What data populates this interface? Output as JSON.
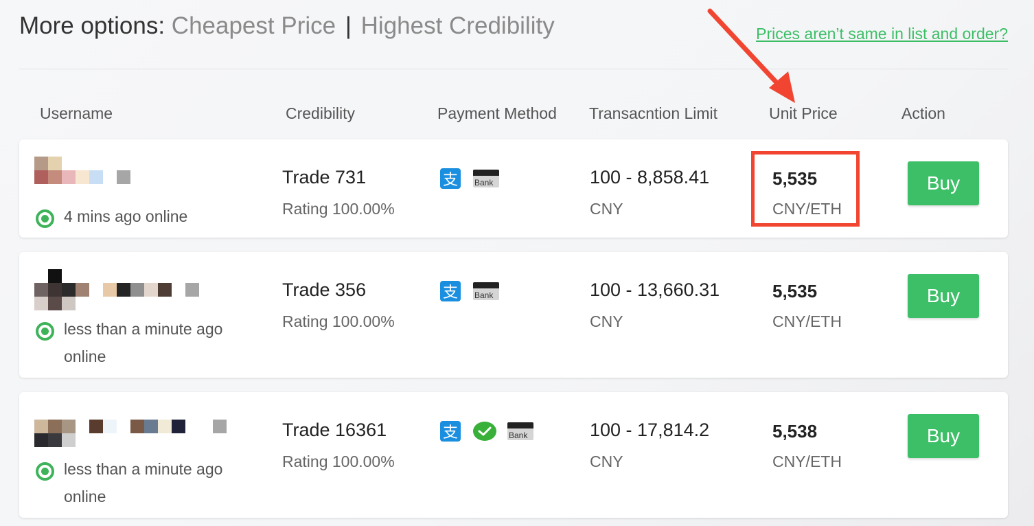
{
  "header": {
    "prefix": "More options:",
    "option_cheapest": "Cheapest Price",
    "separator": "|",
    "option_credibility": "Highest Credibility",
    "help_link": "Prices aren’t same in list and order?"
  },
  "columns": {
    "username": "Username",
    "credibility": "Credibility",
    "payment": "Payment Method",
    "limit": "Transacntion Limit",
    "unit_price": "Unit Price",
    "action": "Action"
  },
  "rows": [
    {
      "status": "4 mins ago online",
      "trade": "Trade 731",
      "rating": "Rating 100.00%",
      "payment_icons": [
        "alipay-icon",
        "bank-card-icon"
      ],
      "bank_label": "Bank",
      "limit": "100 - 8,858.41",
      "limit_currency": "CNY",
      "price": "5,535",
      "price_unit": "CNY/ETH",
      "action": "Buy"
    },
    {
      "status": "less than a minute ago online",
      "trade": "Trade 356",
      "rating": "Rating 100.00%",
      "payment_icons": [
        "alipay-icon",
        "bank-card-icon"
      ],
      "bank_label": "Bank",
      "limit": "100 - 13,660.31",
      "limit_currency": "CNY",
      "price": "5,535",
      "price_unit": "CNY/ETH",
      "action": "Buy"
    },
    {
      "status": "less than a minute ago online",
      "trade": "Trade 16361",
      "rating": "Rating 100.00%",
      "payment_icons": [
        "alipay-icon",
        "wechat-pay-icon",
        "bank-card-icon"
      ],
      "bank_label": "Bank",
      "limit": "100 - 17,814.2",
      "limit_currency": "CNY",
      "price": "5,538",
      "price_unit": "CNY/ETH",
      "action": "Buy"
    }
  ],
  "colors": {
    "accent_green": "#3dbf68",
    "online_green": "#3eb35a",
    "annotation_red": "#f14531",
    "alipay_blue": "#1a8fe0"
  }
}
